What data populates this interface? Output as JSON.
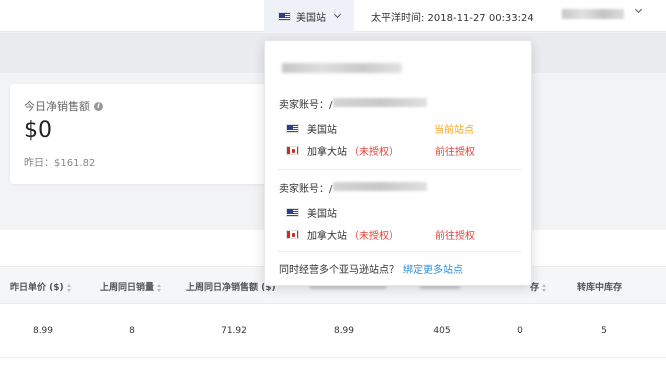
{
  "header": {
    "site_selector": {
      "label": "美国站",
      "flag_icon": "us-flag-icon"
    },
    "timezone_text": "太平洋时间: 2018-11-27 00:33:24"
  },
  "summary_card": {
    "title": "今日净销售额",
    "value": "$0",
    "yesterday_text": "昨日：$161.82"
  },
  "table": {
    "columns": [
      "昨日单价 ($)",
      "上周同日销量",
      "上周同日净销售额 ($)",
      "",
      "",
      "存",
      "转库中库存"
    ],
    "row": [
      "8.99",
      "8",
      "71.92",
      "8.99",
      "405",
      "0",
      "5"
    ]
  },
  "site_dropdown": {
    "groups": [
      {
        "seller_label": "卖家账号：/",
        "sites": [
          {
            "name": "美国站",
            "flag_icon": "us-flag-icon",
            "unauthorized_note": "",
            "action": "当前站点",
            "action_type": "current"
          },
          {
            "name": "加拿大站",
            "flag_icon": "canada-flag-icon",
            "unauthorized_note": "（未授权）",
            "action": "前往授权",
            "action_type": "authorize"
          }
        ]
      },
      {
        "seller_label": "卖家账号：/",
        "sites": [
          {
            "name": "美国站",
            "flag_icon": "us-flag-icon",
            "unauthorized_note": "",
            "action": "",
            "action_type": ""
          },
          {
            "name": "加拿大站",
            "flag_icon": "canada-flag-icon",
            "unauthorized_note": "（未授权）",
            "action": "前往授权",
            "action_type": "authorize"
          }
        ]
      }
    ],
    "footer_text": "同时经营多个亚马逊站点？",
    "footer_link": "绑定更多站点"
  },
  "colors": {
    "current_site": "#f5a623",
    "authorize": "#e8413b",
    "link": "#2e8ce0"
  }
}
